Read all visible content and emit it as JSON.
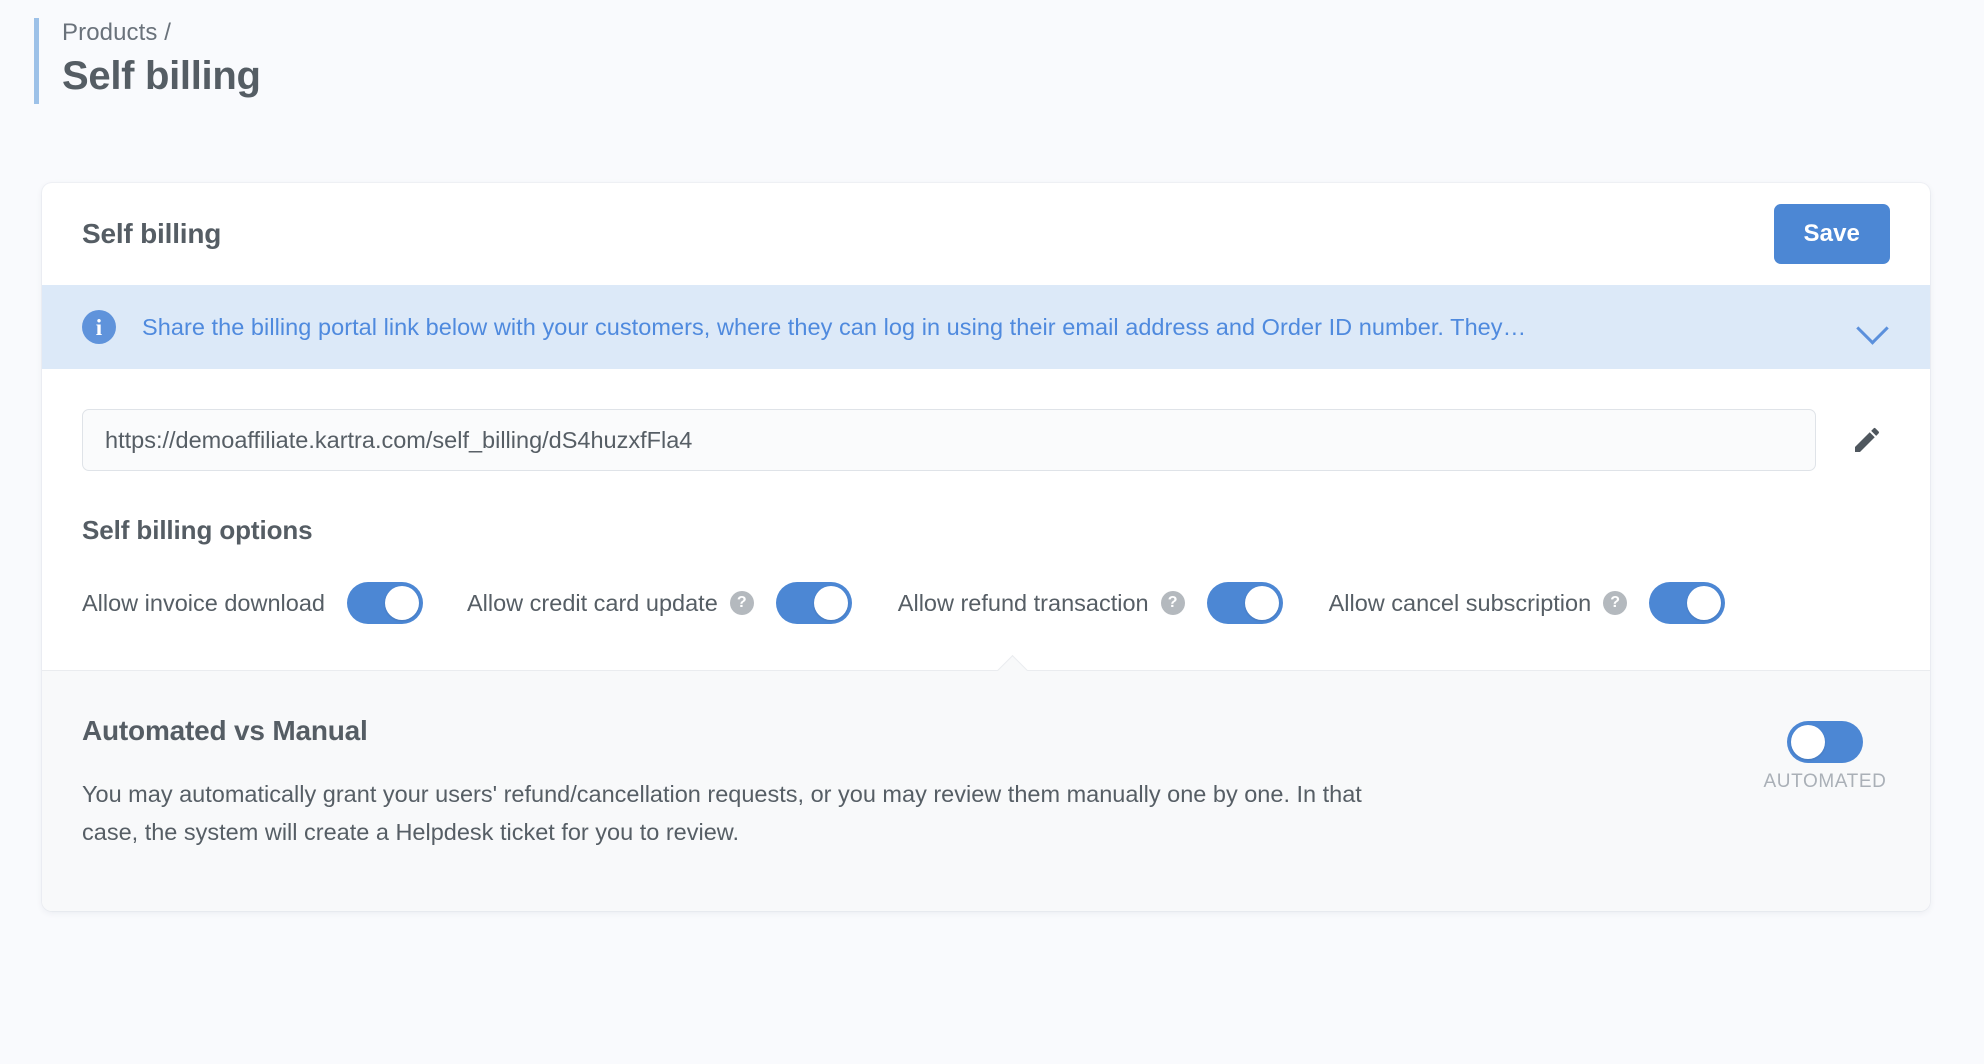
{
  "header": {
    "breadcrumb": "Products /",
    "title": "Self billing"
  },
  "card": {
    "title": "Self billing",
    "save_label": "Save",
    "accent_color": "#4c87d4"
  },
  "info_banner": {
    "icon": "info-circle-icon",
    "text": "Share the billing portal link below with your customers, where they can log in using their email address and Order ID number. They…",
    "expand_icon": "chevron-down-icon",
    "background_color": "#dce9f8",
    "text_color": "#4f8ade"
  },
  "billing_link": {
    "value": "https://demoaffiliate.kartra.com/self_billing/dS4huzxfFla4",
    "placeholder": "https://",
    "edit_icon": "pencil-icon"
  },
  "options": {
    "title": "Self billing options",
    "items": [
      {
        "label": "Allow invoice download",
        "help": false,
        "help_glyph": "?",
        "state": "on"
      },
      {
        "label": "Allow credit card update",
        "help": true,
        "help_glyph": "?",
        "state": "on"
      },
      {
        "label": "Allow refund transaction",
        "help": true,
        "help_glyph": "?",
        "state": "on"
      },
      {
        "label": "Allow cancel subscription",
        "help": true,
        "help_glyph": "?",
        "state": "on"
      }
    ]
  },
  "automated": {
    "title": "Automated vs Manual",
    "description": "You may automatically grant your users' refund/cancellation requests, or you may review them manually one by one. In that case, the system will create a Helpdesk ticket for you to review.",
    "mode_label": "AUTOMATED",
    "state": "off"
  }
}
